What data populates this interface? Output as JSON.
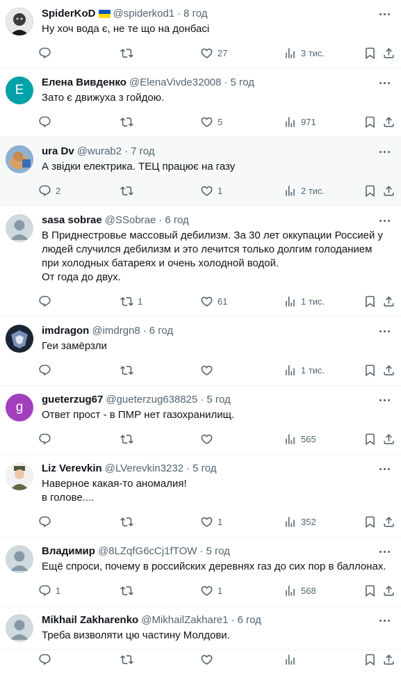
{
  "colors": {
    "muted": "#536471",
    "text": "#0f1419",
    "highlight_bg": "#f7f9f9",
    "divider": "#eff3f4"
  },
  "tweets": [
    {
      "name": "SpiderKoD",
      "flag": "ukraine-flag",
      "handle": "@spiderkod1",
      "time": "8 год",
      "text": "Ну хоч вода є, не те що на донбасі",
      "replies": "",
      "retweets": "",
      "likes": "27",
      "views": "3 тис.",
      "avatar": {
        "kind": "photo",
        "bg": "#2b2b2b"
      }
    },
    {
      "name": "Елена Вивденко",
      "handle": "@ElenaVivde32008",
      "time": "5 год",
      "text": "Зато є движуха з гойдою.",
      "replies": "",
      "retweets": "",
      "likes": "5",
      "views": "971",
      "avatar": {
        "kind": "letter",
        "letter": "E",
        "bg": "#00a2a8"
      }
    },
    {
      "name": "ura Dv",
      "handle": "@wurab2",
      "time": "7 год",
      "text": "А звідки електрика.  ТЕЦ працює на газу",
      "replies": "2",
      "retweets": "",
      "likes": "1",
      "views": "2 тис.",
      "avatar": {
        "kind": "photo",
        "bg": "#6b8fb3"
      },
      "highlight": true
    },
    {
      "name": "sasa sobrae",
      "handle": "@SSobrae",
      "time": "6 год",
      "text": "В Приднестровье массовый дебилизм. За 30 лет оккупации Россией у людей случился дебилизм и это лечится только долгим голоданием при холодных батареях и очень холодной водой.\nОт года до двух.",
      "replies": "",
      "retweets": "1",
      "likes": "61",
      "views": "1 тис.",
      "avatar": {
        "kind": "default",
        "bg": "#cfd9de"
      }
    },
    {
      "name": "imdragon",
      "handle": "@imdrgn8",
      "time": "6 год",
      "text": "Геи замёрзли",
      "replies": "",
      "retweets": "",
      "likes": "",
      "views": "1 тис.",
      "avatar": {
        "kind": "photo",
        "bg": "#1c2533"
      }
    },
    {
      "name": "gueterzug67",
      "handle": "@gueterzug638825",
      "time": "5 год",
      "text": "Ответ прост - в ПМР нет газохранилищ.",
      "replies": "",
      "retweets": "",
      "likes": "",
      "views": "565",
      "avatar": {
        "kind": "letter",
        "letter": "g",
        "bg": "#a23fbd"
      }
    },
    {
      "name": "Liz Verevkin",
      "handle": "@LVerevkin3232",
      "time": "5 год",
      "text": "Наверное какая-то аномалия!\nв голове....",
      "replies": "",
      "retweets": "",
      "likes": "1",
      "views": "352",
      "avatar": {
        "kind": "photo",
        "bg": "#b8c4b0"
      }
    },
    {
      "name": "Владимир",
      "handle": "@8LZqfG6cCj1fTOW",
      "time": "5 год",
      "text": "Ещё спроси, почему в российских деревнях газ до сих пор в баллонах.",
      "replies": "1",
      "retweets": "",
      "likes": "1",
      "views": "568",
      "avatar": {
        "kind": "default",
        "bg": "#cfd9de"
      }
    },
    {
      "name": "Mikhail Zakharenko",
      "handle": "@MikhailZakhare1",
      "time": "6 год",
      "text": "Треба визволяти цю частину Молдови.",
      "replies": "",
      "retweets": "",
      "likes": "",
      "views": "",
      "avatar": {
        "kind": "default",
        "bg": "#cfd9de"
      }
    }
  ]
}
